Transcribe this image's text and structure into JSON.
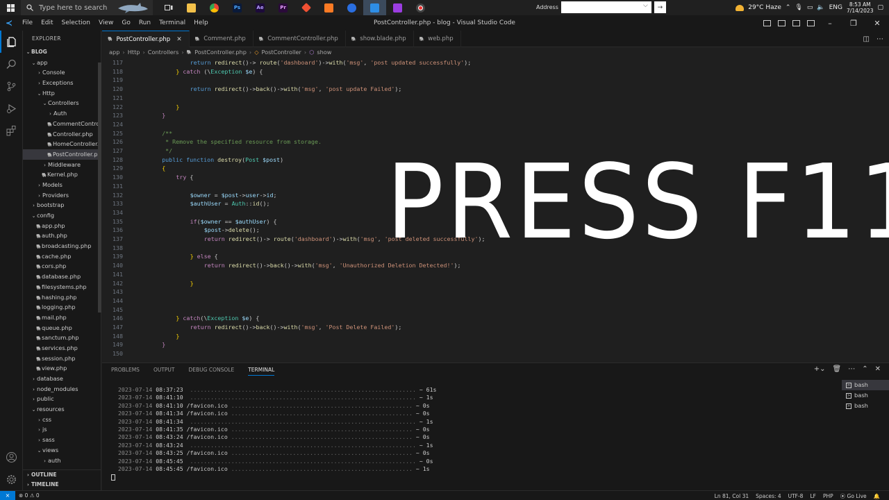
{
  "taskbar": {
    "search_placeholder": "Type here to search",
    "address_label": "Address",
    "weather": "29°C  Haze",
    "language": "ENG",
    "time": "8:53 AM",
    "date": "7/14/2023"
  },
  "titlebar": {
    "menu": [
      "File",
      "Edit",
      "Selection",
      "View",
      "Go",
      "Run",
      "Terminal",
      "Help"
    ],
    "title": "PostController.php - blog - Visual Studio Code"
  },
  "sidebar": {
    "header": "EXPLORER",
    "project": "BLOG",
    "items": [
      {
        "label": "app",
        "depth": 1,
        "kind": "folder-open"
      },
      {
        "label": "Console",
        "depth": 2,
        "kind": "folder"
      },
      {
        "label": "Exceptions",
        "depth": 2,
        "kind": "folder"
      },
      {
        "label": "Http",
        "depth": 2,
        "kind": "folder-open"
      },
      {
        "label": "Controllers",
        "depth": 3,
        "kind": "folder-open"
      },
      {
        "label": "Auth",
        "depth": 4,
        "kind": "folder"
      },
      {
        "label": "CommentControl...",
        "depth": 4,
        "kind": "php"
      },
      {
        "label": "Controller.php",
        "depth": 4,
        "kind": "php"
      },
      {
        "label": "HomeController....",
        "depth": 4,
        "kind": "php"
      },
      {
        "label": "PostController.php",
        "depth": 4,
        "kind": "php",
        "selected": true
      },
      {
        "label": "Middleware",
        "depth": 3,
        "kind": "folder"
      },
      {
        "label": "Kernel.php",
        "depth": 3,
        "kind": "php"
      },
      {
        "label": "Models",
        "depth": 2,
        "kind": "folder"
      },
      {
        "label": "Providers",
        "depth": 2,
        "kind": "folder"
      },
      {
        "label": "bootstrap",
        "depth": 1,
        "kind": "folder"
      },
      {
        "label": "config",
        "depth": 1,
        "kind": "folder-open"
      },
      {
        "label": "app.php",
        "depth": 2,
        "kind": "php"
      },
      {
        "label": "auth.php",
        "depth": 2,
        "kind": "php"
      },
      {
        "label": "broadcasting.php",
        "depth": 2,
        "kind": "php"
      },
      {
        "label": "cache.php",
        "depth": 2,
        "kind": "php"
      },
      {
        "label": "cors.php",
        "depth": 2,
        "kind": "php"
      },
      {
        "label": "database.php",
        "depth": 2,
        "kind": "php"
      },
      {
        "label": "filesystems.php",
        "depth": 2,
        "kind": "php"
      },
      {
        "label": "hashing.php",
        "depth": 2,
        "kind": "php"
      },
      {
        "label": "logging.php",
        "depth": 2,
        "kind": "php"
      },
      {
        "label": "mail.php",
        "depth": 2,
        "kind": "php"
      },
      {
        "label": "queue.php",
        "depth": 2,
        "kind": "php"
      },
      {
        "label": "sanctum.php",
        "depth": 2,
        "kind": "php"
      },
      {
        "label": "services.php",
        "depth": 2,
        "kind": "php"
      },
      {
        "label": "session.php",
        "depth": 2,
        "kind": "php"
      },
      {
        "label": "view.php",
        "depth": 2,
        "kind": "php"
      },
      {
        "label": "database",
        "depth": 1,
        "kind": "folder"
      },
      {
        "label": "node_modules",
        "depth": 1,
        "kind": "folder"
      },
      {
        "label": "public",
        "depth": 1,
        "kind": "folder"
      },
      {
        "label": "resources",
        "depth": 1,
        "kind": "folder-open"
      },
      {
        "label": "css",
        "depth": 2,
        "kind": "folder"
      },
      {
        "label": "js",
        "depth": 2,
        "kind": "folder"
      },
      {
        "label": "sass",
        "depth": 2,
        "kind": "folder"
      },
      {
        "label": "views",
        "depth": 2,
        "kind": "folder-open"
      },
      {
        "label": "auth",
        "depth": 3,
        "kind": "folder"
      }
    ],
    "outline": "OUTLINE",
    "timeline": "TIMELINE"
  },
  "tabs": [
    {
      "label": "PostController.php",
      "active": true
    },
    {
      "label": "Comment.php"
    },
    {
      "label": "CommentController.php"
    },
    {
      "label": "show.blade.php"
    },
    {
      "label": "web.php"
    }
  ],
  "breadcrumb": [
    "app",
    "Http",
    "Controllers",
    "PostController.php",
    "PostController",
    "show"
  ],
  "code": [
    {
      "n": "117",
      "indent": 12,
      "tokens": [
        [
          "kw",
          "return "
        ],
        [
          "fn",
          "redirect"
        ],
        [
          "",
          "()-> "
        ],
        [
          "fn",
          "route"
        ],
        [
          "",
          "("
        ],
        [
          "st",
          "'dashboard'"
        ],
        [
          "",
          ")->"
        ],
        [
          "fn",
          "with"
        ],
        [
          "",
          "("
        ],
        [
          "st",
          "'msg'"
        ],
        [
          "",
          ", "
        ],
        [
          "st",
          "'post updated successfully'"
        ],
        [
          "",
          ");"
        ]
      ]
    },
    {
      "n": "118",
      "indent": 8,
      "tokens": [
        [
          "br",
          "} "
        ],
        [
          "pk",
          "catch "
        ],
        [
          "",
          "(\\"
        ],
        [
          "cl",
          "Exception "
        ],
        [
          "vr",
          "$e"
        ],
        [
          "",
          ") {"
        ]
      ]
    },
    {
      "n": "119",
      "indent": 0,
      "tokens": []
    },
    {
      "n": "120",
      "indent": 12,
      "tokens": [
        [
          "kw",
          "return "
        ],
        [
          "fn",
          "redirect"
        ],
        [
          "",
          "()->"
        ],
        [
          "fn",
          "back"
        ],
        [
          "",
          "()->"
        ],
        [
          "fn",
          "with"
        ],
        [
          "",
          "("
        ],
        [
          "st",
          "'msg'"
        ],
        [
          "",
          ", "
        ],
        [
          "st",
          "'post update Failed'"
        ],
        [
          "",
          ");"
        ]
      ]
    },
    {
      "n": "121",
      "indent": 0,
      "tokens": []
    },
    {
      "n": "122",
      "indent": 8,
      "tokens": [
        [
          "br",
          "}"
        ]
      ]
    },
    {
      "n": "123",
      "indent": 4,
      "tokens": [
        [
          "pk",
          "}"
        ]
      ]
    },
    {
      "n": "124",
      "indent": 0,
      "tokens": []
    },
    {
      "n": "125",
      "indent": 4,
      "tokens": [
        [
          "cm",
          "/**"
        ]
      ]
    },
    {
      "n": "126",
      "indent": 4,
      "tokens": [
        [
          "cm",
          " * Remove the specified resource from storage."
        ]
      ]
    },
    {
      "n": "127",
      "indent": 4,
      "tokens": [
        [
          "cm",
          " */"
        ]
      ]
    },
    {
      "n": "128",
      "indent": 4,
      "tokens": [
        [
          "kw",
          "public function "
        ],
        [
          "fn",
          "destroy"
        ],
        [
          "",
          "("
        ],
        [
          "cl",
          "Post "
        ],
        [
          "vr",
          "$post"
        ],
        [
          "",
          ")"
        ]
      ]
    },
    {
      "n": "129",
      "indent": 4,
      "tokens": [
        [
          "br",
          "{"
        ]
      ]
    },
    {
      "n": "130",
      "indent": 8,
      "tokens": [
        [
          "pk",
          "try "
        ],
        [
          "",
          "{"
        ]
      ]
    },
    {
      "n": "131",
      "indent": 0,
      "tokens": []
    },
    {
      "n": "132",
      "indent": 12,
      "tokens": [
        [
          "vr",
          "$owner"
        ],
        [
          "",
          " = "
        ],
        [
          "vr",
          "$post"
        ],
        [
          "",
          "->"
        ],
        [
          "vr",
          "user"
        ],
        [
          "",
          "->"
        ],
        [
          "vr",
          "id"
        ],
        [
          "",
          ";"
        ]
      ]
    },
    {
      "n": "133",
      "indent": 12,
      "tokens": [
        [
          "vr",
          "$authUser"
        ],
        [
          "",
          " = "
        ],
        [
          "cl",
          "Auth"
        ],
        [
          "",
          "::"
        ],
        [
          "fn",
          "id"
        ],
        [
          "",
          "();"
        ]
      ]
    },
    {
      "n": "134",
      "indent": 0,
      "tokens": []
    },
    {
      "n": "135",
      "indent": 12,
      "tokens": [
        [
          "pk",
          "if"
        ],
        [
          "",
          "("
        ],
        [
          "vr",
          "$owner"
        ],
        [
          "",
          " == "
        ],
        [
          "vr",
          "$authUser"
        ],
        [
          "",
          ") {"
        ]
      ]
    },
    {
      "n": "136",
      "indent": 16,
      "tokens": [
        [
          "vr",
          "$post"
        ],
        [
          "",
          "->"
        ],
        [
          "fn",
          "delete"
        ],
        [
          "",
          "();"
        ]
      ]
    },
    {
      "n": "137",
      "indent": 16,
      "tokens": [
        [
          "pk",
          "return "
        ],
        [
          "fn",
          "redirect"
        ],
        [
          "",
          "()-> "
        ],
        [
          "fn",
          "route"
        ],
        [
          "",
          "("
        ],
        [
          "st",
          "'dashboard'"
        ],
        [
          "",
          ")->"
        ],
        [
          "fn",
          "with"
        ],
        [
          "",
          "("
        ],
        [
          "st",
          "'msg'"
        ],
        [
          "",
          ", "
        ],
        [
          "st",
          "'post deleted successfully'"
        ],
        [
          "",
          ");"
        ]
      ]
    },
    {
      "n": "138",
      "indent": 0,
      "tokens": []
    },
    {
      "n": "139",
      "indent": 12,
      "tokens": [
        [
          "br",
          "} "
        ],
        [
          "pk",
          "else "
        ],
        [
          "",
          "{"
        ]
      ]
    },
    {
      "n": "140",
      "indent": 16,
      "tokens": [
        [
          "pk",
          "return "
        ],
        [
          "fn",
          "redirect"
        ],
        [
          "",
          "()->"
        ],
        [
          "fn",
          "back"
        ],
        [
          "",
          "()->"
        ],
        [
          "fn",
          "with"
        ],
        [
          "",
          "("
        ],
        [
          "st",
          "'msg'"
        ],
        [
          "",
          ", "
        ],
        [
          "st",
          "'Unauthorized Deletion Detected!'"
        ],
        [
          "",
          ");"
        ]
      ]
    },
    {
      "n": "141",
      "indent": 0,
      "tokens": []
    },
    {
      "n": "142",
      "indent": 12,
      "tokens": [
        [
          "br",
          "}"
        ]
      ]
    },
    {
      "n": "143",
      "indent": 0,
      "tokens": []
    },
    {
      "n": "144",
      "indent": 0,
      "tokens": []
    },
    {
      "n": "145",
      "indent": 0,
      "tokens": []
    },
    {
      "n": "146",
      "indent": 8,
      "tokens": [
        [
          "br",
          "} "
        ],
        [
          "pk",
          "catch"
        ],
        [
          "",
          "(\\"
        ],
        [
          "cl",
          "Exception "
        ],
        [
          "vr",
          "$e"
        ],
        [
          "",
          ") {"
        ]
      ]
    },
    {
      "n": "147",
      "indent": 12,
      "tokens": [
        [
          "pk",
          "return "
        ],
        [
          "fn",
          "redirect"
        ],
        [
          "",
          "()->"
        ],
        [
          "fn",
          "back"
        ],
        [
          "",
          "()->"
        ],
        [
          "fn",
          "with"
        ],
        [
          "",
          "("
        ],
        [
          "st",
          "'msg'"
        ],
        [
          "",
          ", "
        ],
        [
          "st",
          "'Post Delete Failed'"
        ],
        [
          "",
          ");"
        ]
      ]
    },
    {
      "n": "148",
      "indent": 8,
      "tokens": [
        [
          "br",
          "}"
        ]
      ]
    },
    {
      "n": "149",
      "indent": 4,
      "tokens": [
        [
          "pk",
          "}"
        ]
      ]
    },
    {
      "n": "150",
      "indent": 0,
      "tokens": []
    }
  ],
  "overlay": "PRESS F11",
  "panel": {
    "tabs": [
      "PROBLEMS",
      "OUTPUT",
      "DEBUG CONSOLE",
      "TERMINAL"
    ],
    "active_tab": "TERMINAL",
    "log": [
      {
        "date": "2023-07-14",
        "time": "08:37:23",
        "path": "",
        "dur": "~ 61s"
      },
      {
        "date": "2023-07-14",
        "time": "08:41:10",
        "path": "",
        "dur": "~ 1s"
      },
      {
        "date": "2023-07-14",
        "time": "08:41:10",
        "path": "/favicon.ico",
        "dur": "~ 0s"
      },
      {
        "date": "2023-07-14",
        "time": "08:41:34",
        "path": "/favicon.ico",
        "dur": "~ 0s"
      },
      {
        "date": "2023-07-14",
        "time": "08:41:34",
        "path": "",
        "dur": "~ 1s"
      },
      {
        "date": "2023-07-14",
        "time": "08:41:35",
        "path": "/favicon.ico",
        "dur": "~ 0s"
      },
      {
        "date": "2023-07-14",
        "time": "08:43:24",
        "path": "/favicon.ico",
        "dur": "~ 0s"
      },
      {
        "date": "2023-07-14",
        "time": "08:43:24",
        "path": "",
        "dur": "~ 1s"
      },
      {
        "date": "2023-07-14",
        "time": "08:43:25",
        "path": "/favicon.ico",
        "dur": "~ 0s"
      },
      {
        "date": "2023-07-14",
        "time": "08:45:45",
        "path": "",
        "dur": "~ 0s"
      },
      {
        "date": "2023-07-14",
        "time": "08:45:45",
        "path": "/favicon.ico",
        "dur": "~ 1s"
      }
    ],
    "terminals": [
      "bash",
      "bash",
      "bash"
    ]
  },
  "statusbar": {
    "problems": "⊗ 0 ⚠ 0",
    "position": "Ln 81, Col 31",
    "spaces": "Spaces: 4",
    "encoding": "UTF-8",
    "eol": "LF",
    "language": "PHP",
    "golive": "Go Live"
  },
  "colors": {
    "accent": "#0078d4",
    "php_icon": "#a074c4"
  }
}
